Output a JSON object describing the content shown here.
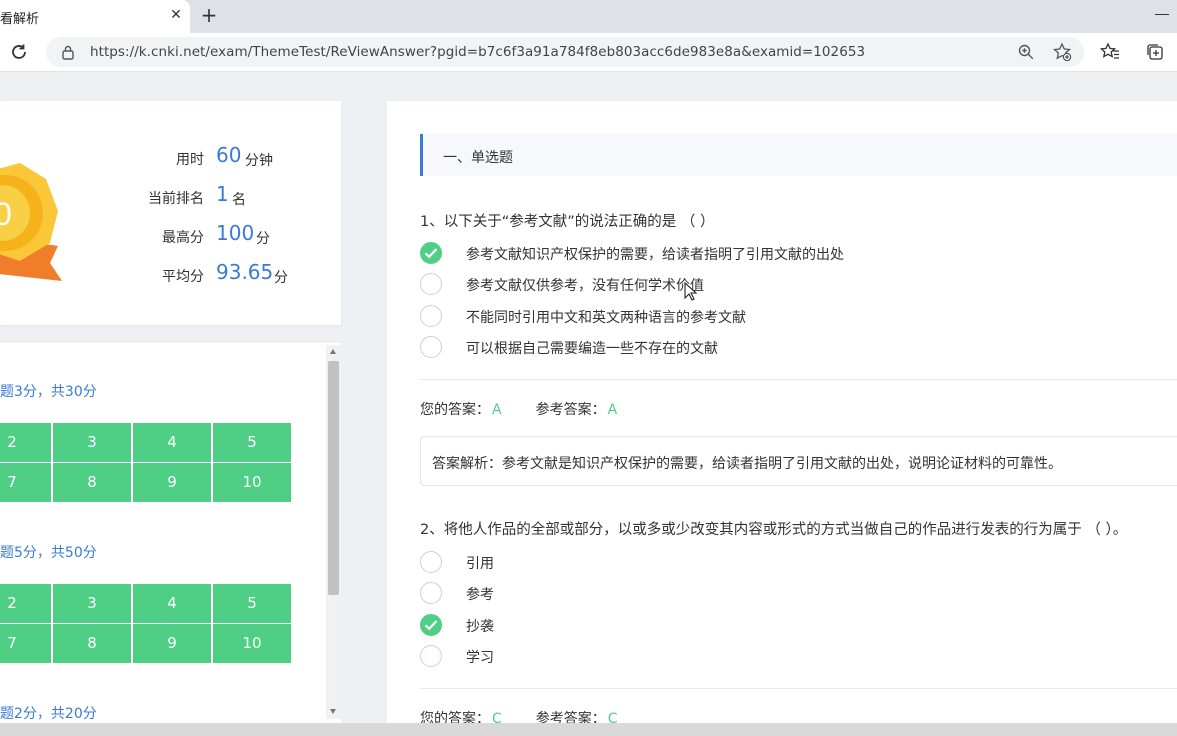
{
  "browser": {
    "tab_title": "看解析",
    "tab_close": "✕",
    "new_tab": "+",
    "url": "https://k.cnki.net/exam/ThemeTest/ReViewAnswer?pgid=b7c6f3a91a784f8eb803acc6de983e8a&examid=102653"
  },
  "score": {
    "medal_digit": "0",
    "stats": [
      {
        "label": "用时",
        "value": "60",
        "unit": "分钟"
      },
      {
        "label": "当前排名",
        "value": "1",
        "unit": "名"
      },
      {
        "label": "最高分",
        "value": "100",
        "unit": "分"
      },
      {
        "label": "平均分",
        "value": "93.65",
        "unit": "分"
      }
    ]
  },
  "sheet": {
    "sections": [
      {
        "info": "题3分，共30分",
        "rows": [
          [
            "2",
            "3",
            "4",
            "5"
          ],
          [
            "7",
            "8",
            "9",
            "10"
          ]
        ]
      },
      {
        "info": "题5分，共50分",
        "rows": [
          [
            "2",
            "3",
            "4",
            "5"
          ],
          [
            "7",
            "8",
            "9",
            "10"
          ]
        ]
      },
      {
        "info": "题2分，共20分"
      }
    ]
  },
  "questions_panel": {
    "section_title": "一、单选题",
    "answer_label": "您的答案：",
    "reference_label": "参考答案：",
    "questions": [
      {
        "text": "1、以下关于“参考文献”的说法正确的是 （ ）",
        "options": [
          "参考文献知识产权保护的需要，给读者指明了引用文献的出处",
          "参考文献仅供参考，没有任何学术价值",
          "不能同时引用中文和英文两种语言的参考文献",
          "可以根据自己需要编造一些不存在的文献"
        ],
        "selected_index": 0,
        "your_answer": "A",
        "ref_answer": "A",
        "analysis": "答案解析：参考文献是知识产权保护的需要，给读者指明了引用文献的出处，说明论证材料的可靠性。"
      },
      {
        "text": "2、将他人作品的全部或部分，以或多或少改变其内容或形式的方式当做自己的作品进行发表的行为属于 （ ）。",
        "options": [
          "引用",
          "参考",
          "抄袭",
          "学习"
        ],
        "selected_index": 2,
        "your_answer": "C",
        "ref_answer": "C"
      }
    ]
  },
  "colors": {
    "accent_blue": "#3a7bd5",
    "correct_green": "#4fcf86",
    "medal_gold": "#f5b21a",
    "ribbon_orange": "#f07d2a"
  }
}
